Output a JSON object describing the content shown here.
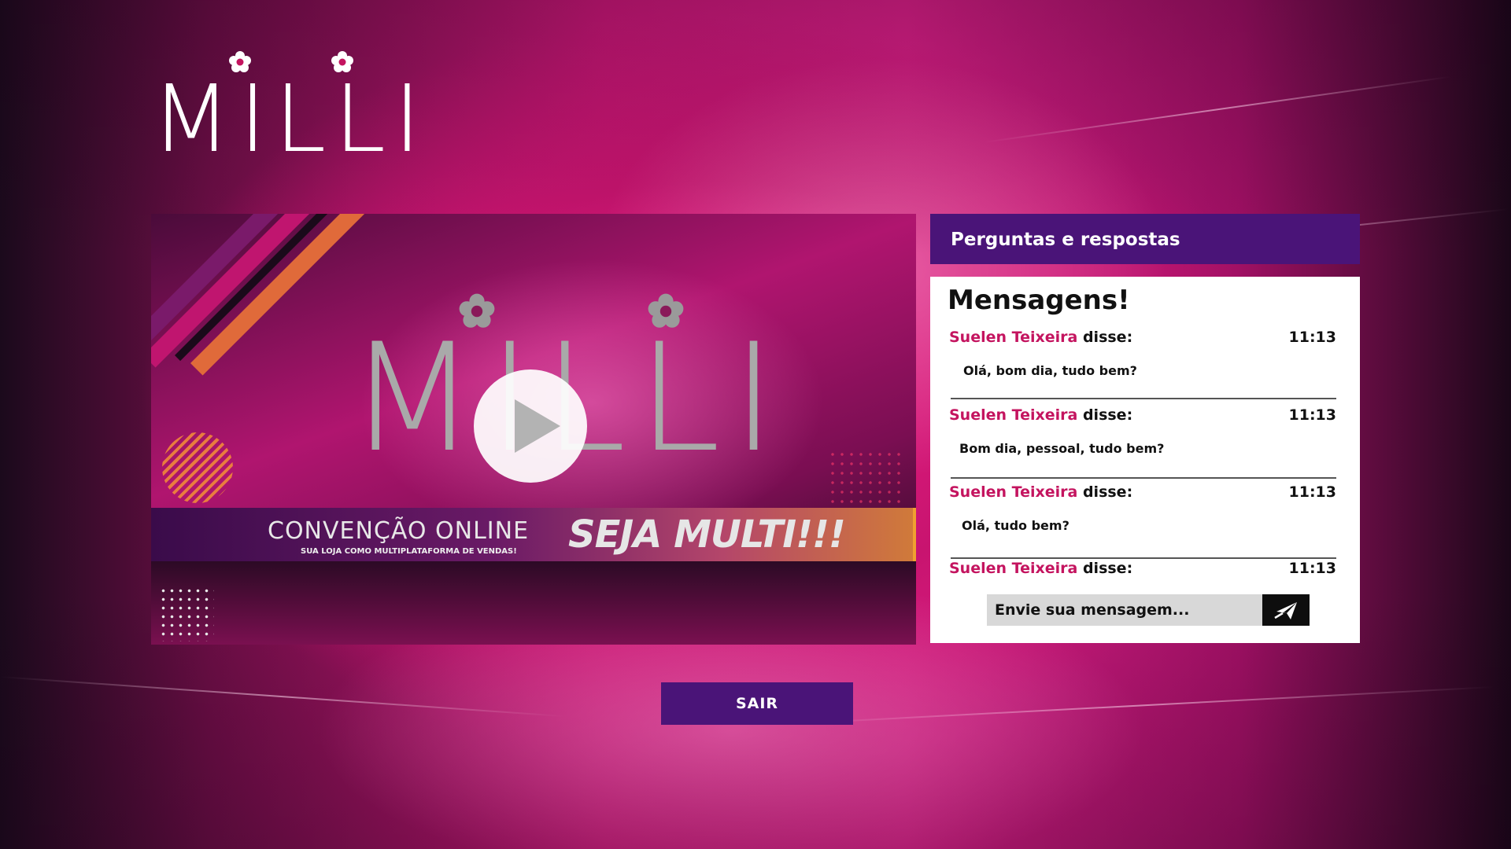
{
  "brand": {
    "logo_text": "MILLI"
  },
  "video": {
    "logo_text": "MILLI",
    "banner_title": "CONVENÇÃO ONLINE",
    "banner_subtitle": "SUA LOJA COMO MULTIPLATAFORMA DE VENDAS!",
    "banner_highlight": "SEJA MULTI!!!",
    "colors": {
      "banner_start": "#3a0b4a",
      "banner_end": "#d07a3a",
      "accent_orange": "#f0a030"
    }
  },
  "qa": {
    "header_title": "Perguntas e respostas",
    "panel_title": "Mensagens!",
    "said_label": "disse:",
    "messages": [
      {
        "author": "Suelen Teixeira",
        "time": "11:13",
        "text": "Olá, bom dia, tudo bem?"
      },
      {
        "author": "Suelen Teixeira",
        "time": "11:13",
        "text": "Bom dia, pessoal, tudo bem?"
      },
      {
        "author": "Suelen Teixeira",
        "time": "11:13",
        "text": "Olá, tudo bem?"
      },
      {
        "author": "Suelen Teixeira",
        "time": "11:13",
        "text": ""
      }
    ],
    "input_placeholder": "Envie sua mensagem...",
    "send_icon": "paper-plane-icon"
  },
  "exit_label": "SAIR",
  "colors": {
    "primary_purple": "#4a1478",
    "author_pink": "#c4145f",
    "background_pink": "#e0208a"
  }
}
